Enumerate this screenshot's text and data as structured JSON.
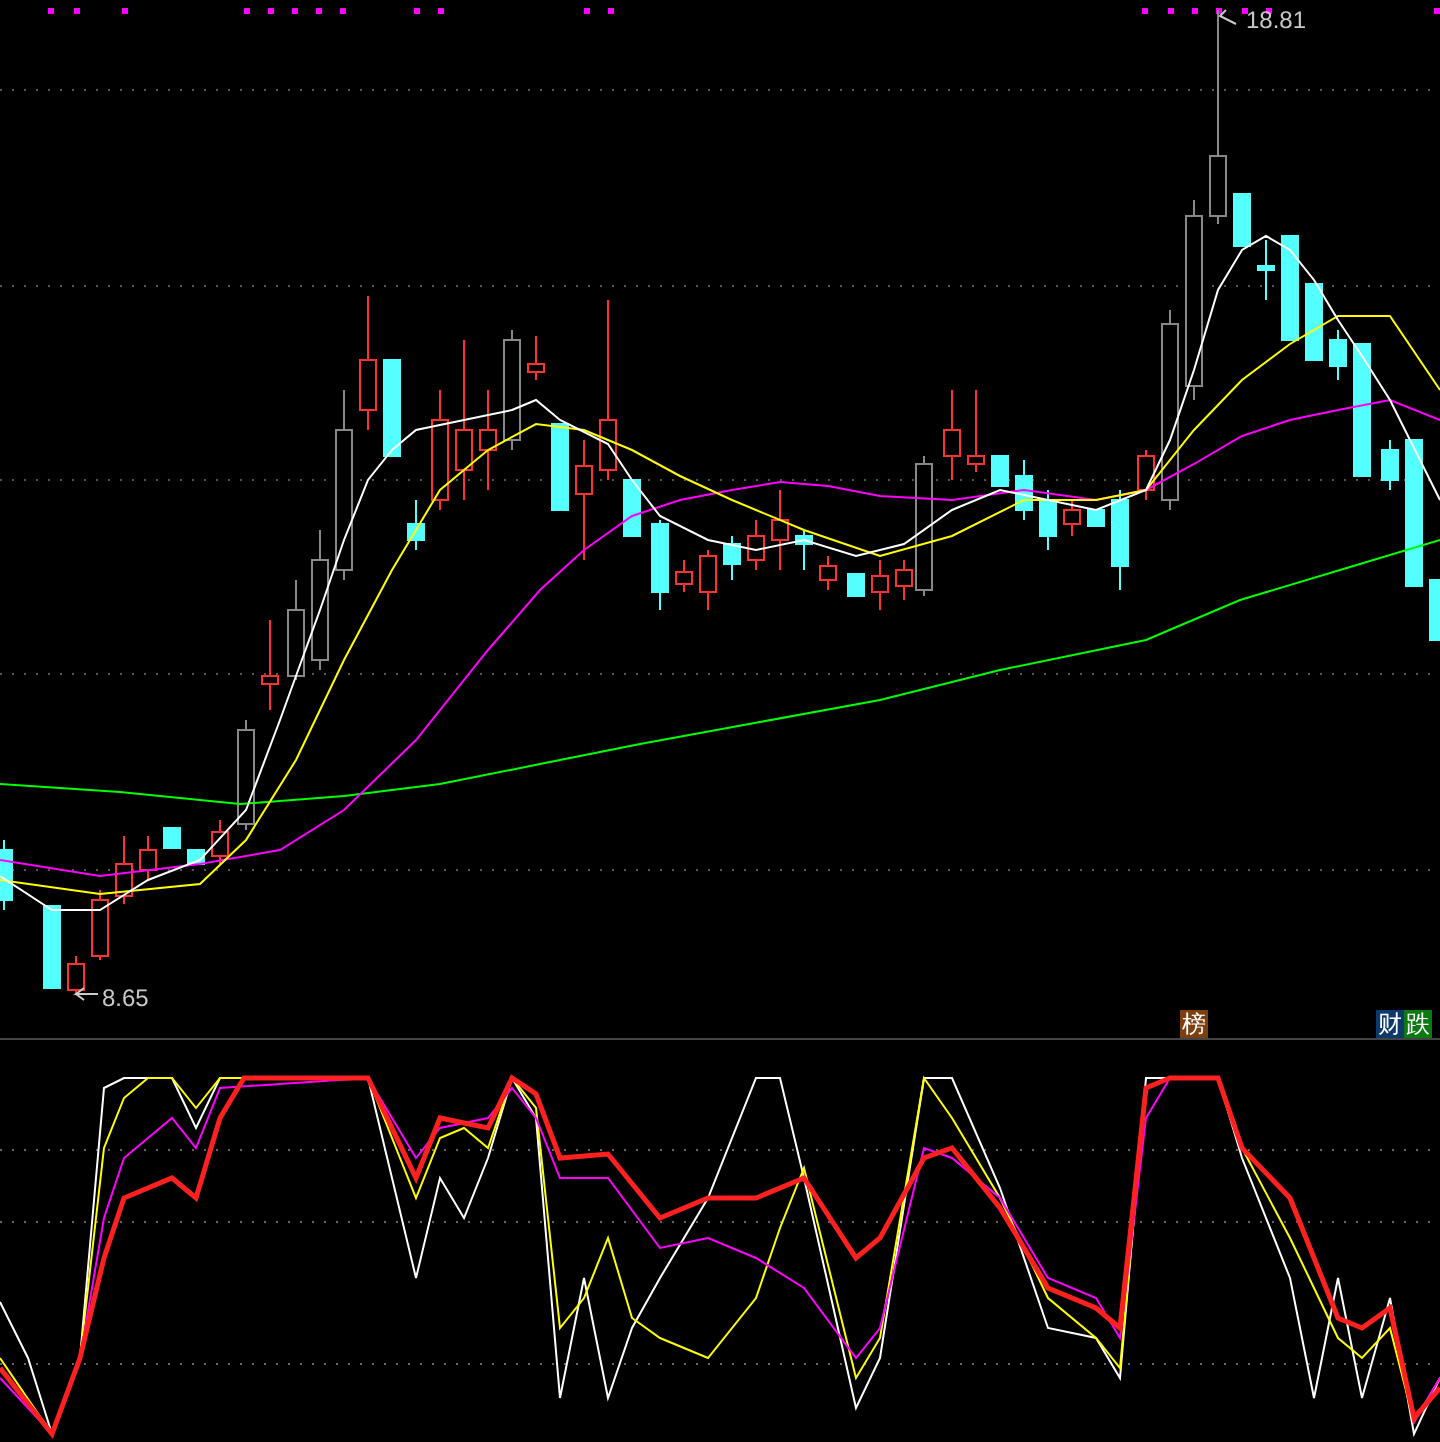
{
  "price_chart": {
    "high_label": "18.81",
    "low_label": "8.65"
  },
  "badges": [
    {
      "label": "榜",
      "color": "#7b3f10"
    },
    {
      "label": "财",
      "color": "#0d3a6b"
    },
    {
      "label": "跌",
      "color": "#0b7a12"
    }
  ]
}
